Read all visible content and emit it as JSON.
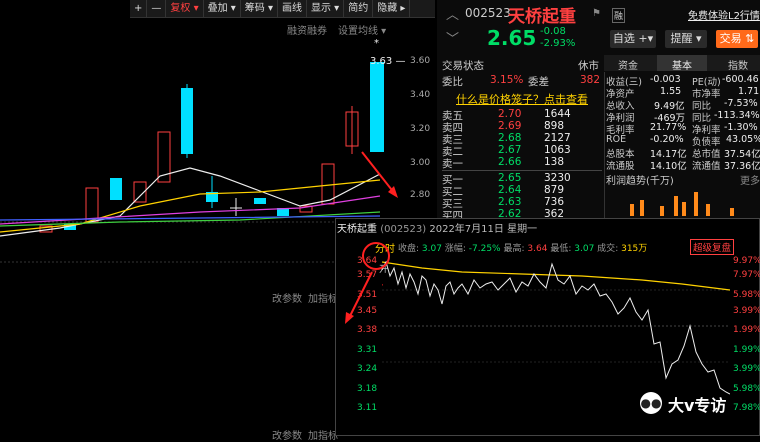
{
  "toolbar": {
    "items": [
      "+",
      "—",
      "复权",
      "叠加",
      "筹码",
      "画线",
      "显示",
      "简约",
      "隐藏"
    ]
  },
  "subbar": {
    "financing": "融资融券",
    "settings": "设置均线"
  },
  "kline": {
    "top_label": "3.63",
    "star": "*",
    "axis": [
      "3.60",
      "3.40",
      "3.20",
      "3.00",
      "2.80"
    ],
    "bottom_labels": [
      "改参数",
      "加指标"
    ],
    "bottom_labels2": [
      "改参数",
      "加指标"
    ]
  },
  "header": {
    "code": "002523",
    "name": "天桥起重",
    "tag": "融",
    "l2": "免费体验L2行情",
    "price": "2.65",
    "change": "-0.08",
    "pct": "-2.93%"
  },
  "actions": {
    "watch": "自选",
    "alert": "提醒",
    "trade": "交易"
  },
  "tabs": {
    "left": "交易状态",
    "status": "休市",
    "r1": "资金",
    "r2": "基本",
    "r3": "指数"
  },
  "ratio": {
    "label1": "委比",
    "val1": "3.15%",
    "label2": "委差",
    "val2": "382"
  },
  "link": "什么是价格笼子？点击查看",
  "asks": [
    [
      "卖五",
      "2.70",
      "1644"
    ],
    [
      "卖四",
      "2.69",
      "898"
    ],
    [
      "卖三",
      "2.68",
      "2127"
    ],
    [
      "卖二",
      "2.67",
      "1063"
    ],
    [
      "卖一",
      "2.66",
      "138"
    ]
  ],
  "bids": [
    [
      "买一",
      "2.65",
      "3230"
    ],
    [
      "买二",
      "2.64",
      "879"
    ],
    [
      "买三",
      "2.63",
      "736"
    ],
    [
      "买四",
      "2.62",
      "362"
    ]
  ],
  "fundamentals": [
    [
      "收益(三)",
      "-0.003",
      "PE(动)",
      "-600.46"
    ],
    [
      "净资产",
      "1.55",
      "市净率",
      "1.71"
    ],
    [
      "总收入",
      "9.49亿",
      "同比",
      "-7.53%"
    ],
    [
      "净利润",
      "-469万",
      "同比",
      "-113.34%"
    ],
    [
      "毛利率",
      "21.77%",
      "净利率",
      "-1.30%"
    ],
    [
      "ROE",
      "-0.20%",
      "负债率",
      "43.05%"
    ],
    [
      "总股本",
      "14.17亿",
      "总市值",
      "37.54亿"
    ],
    [
      "流通股",
      "14.10亿",
      "流通值",
      "37.36亿"
    ]
  ],
  "profit": {
    "title": "利润趋势(千万)",
    "more": "更多"
  },
  "minute": {
    "title": "天桥起重",
    "code": "(002523)",
    "date": "2022年7月11日 星期一",
    "label": "分时",
    "close_l": "收盘",
    "close": "3.07",
    "chg_l": "涨幅",
    "chg": "-7.25%",
    "high_l": "最高",
    "high": "3.64",
    "low_l": "最低",
    "low": "3.07",
    "vol_l": "成交",
    "vol": "315万",
    "badge": "超级复盘",
    "left_axis": [
      "3.64",
      "3.57",
      "3.51",
      "3.45",
      "3.38",
      "3.31",
      "3.24",
      "3.18",
      "3.11"
    ],
    "right_axis": [
      "9.97%",
      "7.97%",
      "5.98%",
      "3.99%",
      "1.99%",
      "1.99%",
      "3.99%",
      "5.98%",
      "7.98%"
    ],
    "first_label": "开",
    "close_pct": "3.07"
  },
  "watermark": "大v专访"
}
